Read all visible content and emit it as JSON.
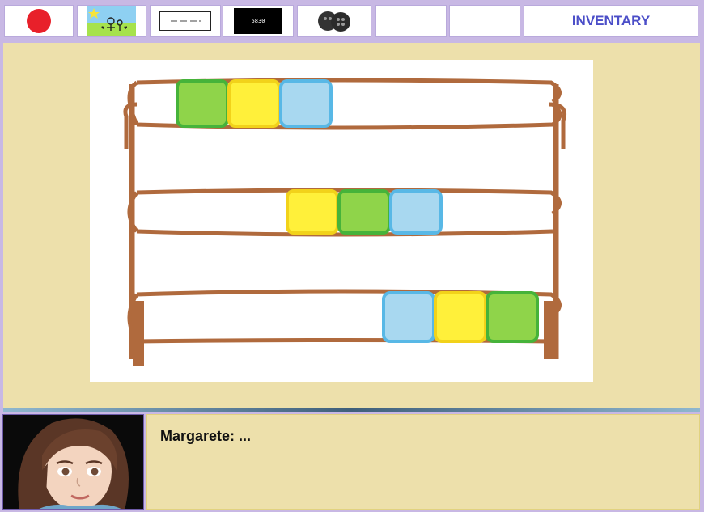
{
  "inventory": {
    "slots": [
      {
        "item": "red-ball"
      },
      {
        "item": "child-drawing"
      },
      {
        "item": "white-note"
      },
      {
        "item": "black-note",
        "text": "5830"
      },
      {
        "item": "buttons"
      },
      {
        "item": ""
      },
      {
        "item": ""
      }
    ],
    "title": "INVENTARY"
  },
  "scene": {
    "object": "abacus",
    "frame_color": "#b06a3d",
    "rows": [
      {
        "beads": [
          "green",
          "yellow",
          "blue"
        ]
      },
      {
        "beads": [
          "yellow",
          "green",
          "blue"
        ]
      },
      {
        "beads": [
          "blue",
          "yellow",
          "green"
        ]
      }
    ],
    "bead_colors": {
      "green": "#8fd44a",
      "yellow": "#fff03a",
      "blue": "#a8d8f0"
    }
  },
  "dialog": {
    "speaker": "Margarete",
    "line": "..."
  }
}
